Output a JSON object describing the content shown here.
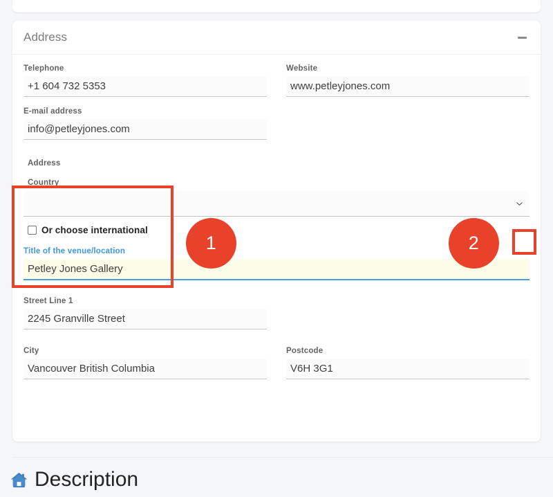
{
  "card_above": {
    "name": "previous-section-card"
  },
  "address_card": {
    "title": "Address",
    "collapse_icon": "minus-icon",
    "fields": {
      "telephone": {
        "label": "Telephone",
        "value": "+1 604 732 5353"
      },
      "website": {
        "label": "Website",
        "value": "www.petleyjones.com"
      },
      "email": {
        "label": "E-mail address",
        "value": "info@petleyjones.com"
      },
      "address_heading": "Address",
      "country": {
        "label": "Country",
        "value": "",
        "caret_icon": "chevron-down-icon"
      },
      "international_checkbox": {
        "label": "Or choose international",
        "checked": false
      },
      "venue_title": {
        "label": "Title of the venue/location",
        "value": "Petley Jones Gallery",
        "focused": true
      },
      "street_line_1": {
        "label": "Street Line 1",
        "value": "2245 Granville Street"
      },
      "city": {
        "label": "City",
        "value": "Vancouver British Columbia"
      },
      "postcode": {
        "label": "Postcode",
        "value": "V6H 3G1"
      }
    }
  },
  "annotations": {
    "marker_1": "1",
    "marker_2": "2",
    "color": "#e8432a"
  },
  "description_section": {
    "icon": "home-icon",
    "title": "Description"
  },
  "colors": {
    "accent_blue": "#4a9fe0",
    "annotation_red": "#e8432a",
    "page_background": "#f5f6f7",
    "card_background": "#ffffff",
    "label_gray": "#636363",
    "autofill_yellow": "#fcfce9"
  }
}
